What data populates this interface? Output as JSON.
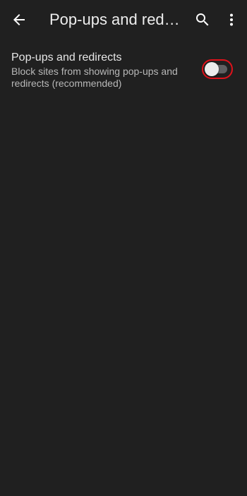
{
  "header": {
    "title": "Pop-ups and redire...",
    "back_icon": "arrow-left-icon",
    "search_icon": "search-icon",
    "more_icon": "more-vert-icon"
  },
  "setting": {
    "title": "Pop-ups and redirects",
    "description": "Block sites from showing pop-ups and redirects (recommended)",
    "toggle_state": "off"
  },
  "colors": {
    "background": "#202020",
    "highlight": "#e0121b",
    "track": "#5f6062",
    "thumb": "#ececec"
  }
}
